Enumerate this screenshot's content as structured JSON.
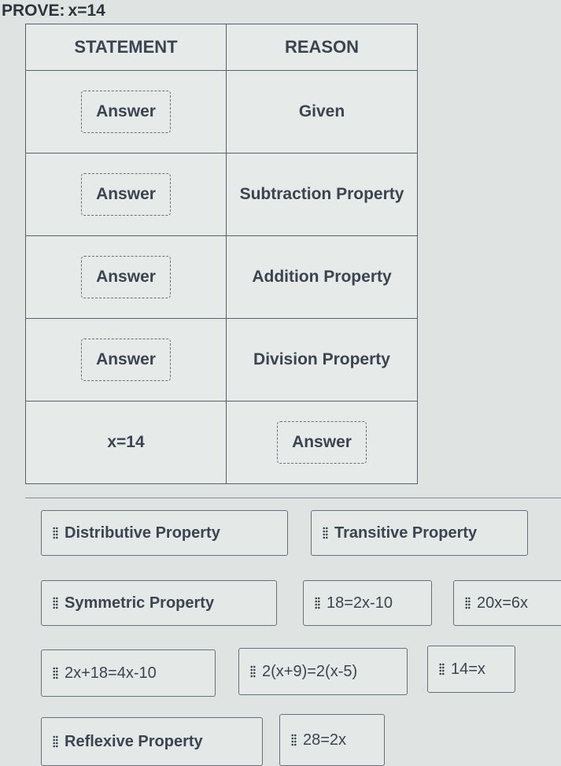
{
  "header": {
    "prove_label": "PROVE:",
    "prove_equation": "x=14"
  },
  "table": {
    "headers": {
      "statement": "STATEMENT",
      "reason": "REASON"
    },
    "rows": [
      {
        "statement": "Answer",
        "statement_is_blank": true,
        "reason": "Given",
        "reason_is_blank": false
      },
      {
        "statement": "Answer",
        "statement_is_blank": true,
        "reason": "Subtraction Property",
        "reason_is_blank": false
      },
      {
        "statement": "Answer",
        "statement_is_blank": true,
        "reason": "Addition Property",
        "reason_is_blank": false
      },
      {
        "statement": "Answer",
        "statement_is_blank": true,
        "reason": "Division Property",
        "reason_is_blank": false
      },
      {
        "statement": "x=14",
        "statement_is_blank": false,
        "reason": "Answer",
        "reason_is_blank": true
      }
    ]
  },
  "answer_bank": {
    "tiles": [
      {
        "label": "Distributive Property",
        "icon": "drag-handle-icon"
      },
      {
        "label": "Transitive Property",
        "icon": "drag-handle-icon"
      },
      {
        "label": "Symmetric Property",
        "icon": "drag-handle-icon"
      },
      {
        "label": "18=2x-10",
        "icon": "drag-handle-icon"
      },
      {
        "label": "20x=6x",
        "icon": "drag-handle-icon"
      },
      {
        "label": "2x+18=4x-10",
        "icon": "drag-handle-icon"
      },
      {
        "label": "2(x+9)=2(x-5)",
        "icon": "drag-handle-icon"
      },
      {
        "label": "14=x",
        "icon": "drag-handle-icon"
      },
      {
        "label": "Reflexive Property",
        "icon": "drag-handle-icon"
      },
      {
        "label": "28=2x",
        "icon": "drag-handle-icon"
      }
    ]
  }
}
